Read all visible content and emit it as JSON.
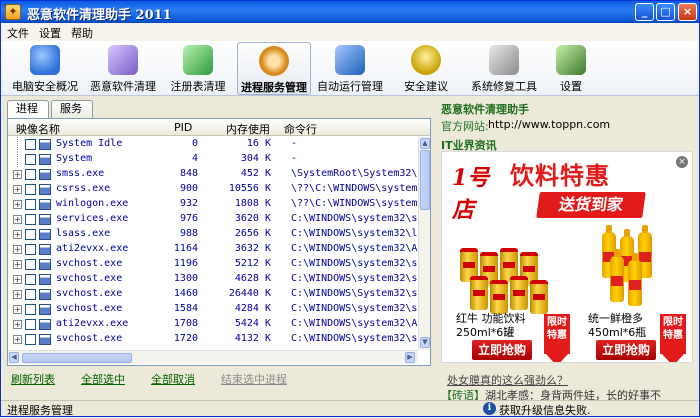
{
  "window": {
    "title": "恶意软件清理助手 2011",
    "title_icon": "rocket-shield-icon"
  },
  "menu": [
    "文件",
    "设置",
    "帮助"
  ],
  "toolbar": [
    {
      "label": "电脑安全概况",
      "icon": "info-shield-icon",
      "color": "#2e6fd8"
    },
    {
      "label": "恶意软件清理",
      "icon": "broom-icon",
      "color": "#7a5bc4"
    },
    {
      "label": "注册表清理",
      "icon": "registry-blocks-icon",
      "color": "#2e9b3e"
    },
    {
      "label": "进程服务管理",
      "icon": "gear-icon",
      "color": "#d88a1a",
      "active": true
    },
    {
      "label": "自动运行管理",
      "icon": "autorun-book-icon",
      "color": "#1b5fb8"
    },
    {
      "label": "安全建议",
      "icon": "advice-icon",
      "color": "#c8a000"
    },
    {
      "label": "系统修复工具",
      "icon": "wrench-screwdriver-icon",
      "color": "#8a8a8a"
    },
    {
      "label": "设置",
      "icon": "settings-clipboard-icon",
      "color": "#3a7a2a"
    }
  ],
  "tabs": [
    "进程",
    "服务"
  ],
  "list": {
    "headers": {
      "name": "映像名称",
      "pid": "PID",
      "mem": "内存使用",
      "cmd": "命令行"
    },
    "rows": [
      {
        "name": "System Idle",
        "pid": "0",
        "mem": "16 K",
        "cmd": "-",
        "expand": false
      },
      {
        "name": "System",
        "pid": "4",
        "mem": "304 K",
        "cmd": "-",
        "expand": false
      },
      {
        "name": "smss.exe",
        "pid": "848",
        "mem": "452 K",
        "cmd": "\\SystemRoot\\System32\\smss.",
        "expand": true
      },
      {
        "name": "csrss.exe",
        "pid": "900",
        "mem": "10556 K",
        "cmd": "\\??\\C:\\WINDOWS\\system32\\cs",
        "expand": true
      },
      {
        "name": "winlogon.exe",
        "pid": "932",
        "mem": "1808 K",
        "cmd": "\\??\\C:\\WINDOWS\\system32\\wi",
        "expand": true
      },
      {
        "name": "services.exe",
        "pid": "976",
        "mem": "3620 K",
        "cmd": "C:\\WINDOWS\\system32\\servic",
        "expand": true
      },
      {
        "name": "lsass.exe",
        "pid": "988",
        "mem": "2656 K",
        "cmd": "C:\\WINDOWS\\system32\\lsass.",
        "expand": true
      },
      {
        "name": "ati2evxx.exe",
        "pid": "1164",
        "mem": "3632 K",
        "cmd": "C:\\WINDOWS\\system32\\Ati2ev",
        "expand": true
      },
      {
        "name": "svchost.exe",
        "pid": "1196",
        "mem": "5212 K",
        "cmd": "C:\\WINDOWS\\system32\\svchos",
        "expand": true
      },
      {
        "name": "svchost.exe",
        "pid": "1300",
        "mem": "4628 K",
        "cmd": "C:\\WINDOWS\\system32\\svchos",
        "expand": true
      },
      {
        "name": "svchost.exe",
        "pid": "1460",
        "mem": "26440 K",
        "cmd": "C:\\WINDOWS\\System32\\svchos",
        "expand": true
      },
      {
        "name": "svchost.exe",
        "pid": "1584",
        "mem": "4284 K",
        "cmd": "C:\\WINDOWS\\system32\\svchos",
        "expand": true
      },
      {
        "name": "ati2evxx.exe",
        "pid": "1708",
        "mem": "5424 K",
        "cmd": "C:\\WINDOWS\\system32\\Ati2ev",
        "expand": true
      },
      {
        "name": "svchost.exe",
        "pid": "1720",
        "mem": "4132 K",
        "cmd": "C:\\WINDOWS\\system32\\svchos",
        "expand": true
      }
    ]
  },
  "actions": {
    "refresh": "刷新列表",
    "select_all": "全部选中",
    "deselect_all": "全部取消",
    "end_selected": "结束选中进程"
  },
  "right_panel": {
    "title": "恶意软件清理助手",
    "site_label": "官方网站:",
    "site_url": "http://www.toppn.com",
    "news_label": "IT业界资讯",
    "ad": {
      "logo": "1号店",
      "headline": "饮料特惠",
      "delivery": "送货到家",
      "product1_name": "红牛 功能饮料",
      "product1_size": "250ml*6罐",
      "product2_name": "统一鲜橙多",
      "product2_size": "450ml*6瓶",
      "tag": "限时特惠",
      "buy": "立即抢购",
      "close": "×"
    },
    "link": "处女膜真的这么强劲么？",
    "ticker_tag": "【砖语】",
    "ticker_text": "湖北孝感：身背两件娃，长的好事不"
  },
  "status": {
    "left": "进程服务管理",
    "right": "获取升级信息失败."
  }
}
